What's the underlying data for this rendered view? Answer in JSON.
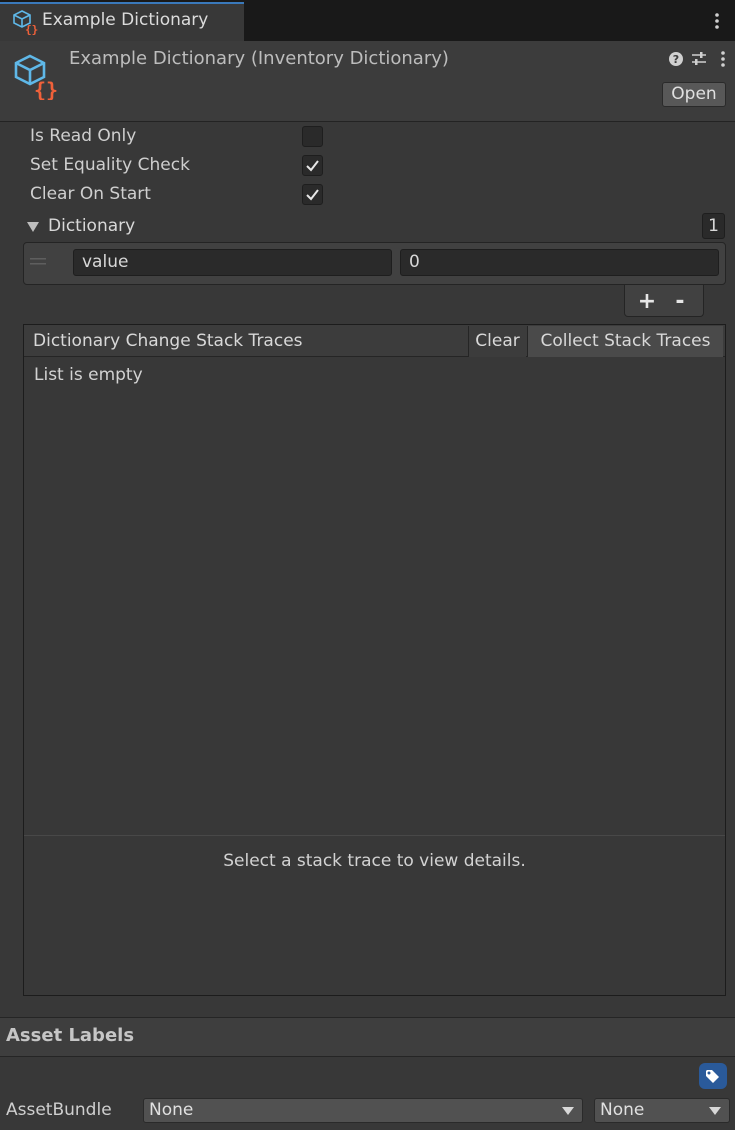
{
  "tab": {
    "title": "Example Dictionary"
  },
  "header": {
    "title": "Example Dictionary (Inventory Dictionary)",
    "open_label": "Open"
  },
  "properties": [
    {
      "label": "Is Read Only",
      "checked": false
    },
    {
      "label": "Set Equality Check",
      "checked": true
    },
    {
      "label": "Clear On Start",
      "checked": true
    }
  ],
  "dictionary": {
    "label": "Dictionary",
    "count": "1",
    "entries": [
      {
        "key": "value",
        "value": "0"
      }
    ],
    "add_label": "+",
    "remove_label": "-"
  },
  "stack_traces": {
    "title": "Dictionary Change Stack Traces",
    "clear_label": "Clear",
    "collect_label": "Collect Stack Traces",
    "empty_text": "List is empty",
    "details_placeholder": "Select a stack trace to view details."
  },
  "asset_labels": {
    "title": "Asset Labels",
    "assetbundle_label": "AssetBundle",
    "bundle_name": "None",
    "bundle_variant": "None"
  },
  "colors": {
    "accent": "#3a79bb",
    "icon_blue": "#5fb8e8",
    "icon_orange": "#f0613a",
    "tag_blue": "#2a5a9a"
  },
  "icons": [
    "scriptable-object-icon",
    "help-icon",
    "preset-icon",
    "kebab-menu-icon",
    "checkmark-icon",
    "triangle-down-icon",
    "drag-handle-icon",
    "tag-icon",
    "dropdown-arrow-icon"
  ]
}
